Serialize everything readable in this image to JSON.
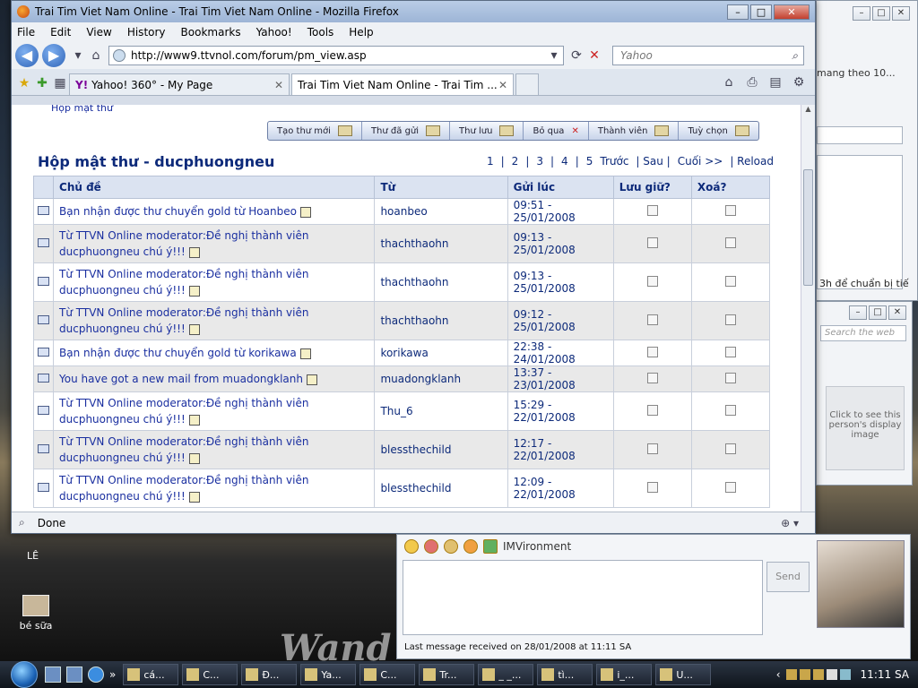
{
  "window": {
    "title": "Trai Tim Viet Nam Online - Trai Tim Viet Nam Online - Mozilla Firefox"
  },
  "menu": [
    "File",
    "Edit",
    "View",
    "History",
    "Bookmarks",
    "Yahoo!",
    "Tools",
    "Help"
  ],
  "nav": {
    "url": "http://www9.ttvnol.com/forum/pm_view.asp",
    "search_placeholder": "Yahoo"
  },
  "tabs": [
    {
      "label": "Yahoo! 360° - My Page"
    },
    {
      "label": "Trai Tim Viet Nam Online - Trai Tim ..."
    }
  ],
  "page": {
    "crumb": "Hộp mật thư",
    "toolbar": [
      "Tạo thư mới",
      "Thư đã gửi",
      "Thư lưu",
      "Bỏ qua",
      "Thành viên",
      "Tuỳ chọn"
    ],
    "title": "Hộp mật thư - ducphuongneu",
    "pager": [
      "1",
      "|",
      "2",
      "|",
      "3",
      "|",
      "4",
      "|",
      "5",
      "Trước",
      "| Sau |",
      "Cuối >>",
      "| Reload"
    ],
    "columns": [
      "Chủ đề",
      "Từ",
      "Gửi lúc",
      "Lưu giữ?",
      "Xoá?"
    ],
    "rows": [
      {
        "subject": "Bạn nhận được thư chuyển gold từ Hoanbeo",
        "from": "hoanbeo",
        "time": "09:51 - 25/01/2008",
        "read": false
      },
      {
        "subject": "Từ TTVN Online moderator:Đề nghị thành viên ducphuongneu chú ý!!!",
        "from": "thachthaohn",
        "time": "09:13 - 25/01/2008",
        "read": true
      },
      {
        "subject": "Từ TTVN Online moderator:Đề nghị thành viên ducphuongneu chú ý!!!",
        "from": "thachthaohn",
        "time": "09:13 - 25/01/2008",
        "read": false
      },
      {
        "subject": "Từ TTVN Online moderator:Đề nghị thành viên ducphuongneu chú ý!!!",
        "from": "thachthaohn",
        "time": "09:12 - 25/01/2008",
        "read": false
      },
      {
        "subject": "Bạn nhận được thư chuyển gold từ korikawa",
        "from": "korikawa",
        "time": "22:38 - 24/01/2008",
        "read": true
      },
      {
        "subject": "You have got a new mail from muadongklanh",
        "from": "muadongklanh",
        "time": "13:37 - 23/01/2008",
        "read": true
      },
      {
        "subject": "Từ TTVN Online moderator:Đề nghị thành viên ducphuongneu chú ý!!!",
        "from": "Thu_6",
        "time": "15:29 - 22/01/2008",
        "read": true
      },
      {
        "subject": "Từ TTVN Online moderator:Đề nghị thành viên ducphuongneu chú ý!!!",
        "from": "blessthechild",
        "time": "12:17 - 22/01/2008",
        "read": true
      },
      {
        "subject": "Từ TTVN Online moderator:Đề nghị thành viên ducphuongneu chú ý!!!",
        "from": "blessthechild",
        "time": "12:09 - 22/01/2008",
        "read": true
      }
    ]
  },
  "status": "Done",
  "bg_right": {
    "line1": "mang theo 10...",
    "line2": "3h để chuẩn bị tiế",
    "search_placeholder": "Search the web",
    "click_text": "Click to see this person's display image"
  },
  "im": {
    "label": "IMVironment",
    "send": "Send",
    "last": "Last message received on 28/01/2008 at 11:11 SA"
  },
  "desktop": {
    "icon1": "bé sữa",
    "icon2": "LÊ",
    "watermark": "Wand"
  },
  "taskbar": {
    "items": [
      "cá...",
      "C...",
      "Đ...",
      "Ya...",
      "C...",
      "Tr...",
      "_ _...",
      "tì...",
      "i_...",
      "U..."
    ],
    "clock": "11:11 SA"
  }
}
